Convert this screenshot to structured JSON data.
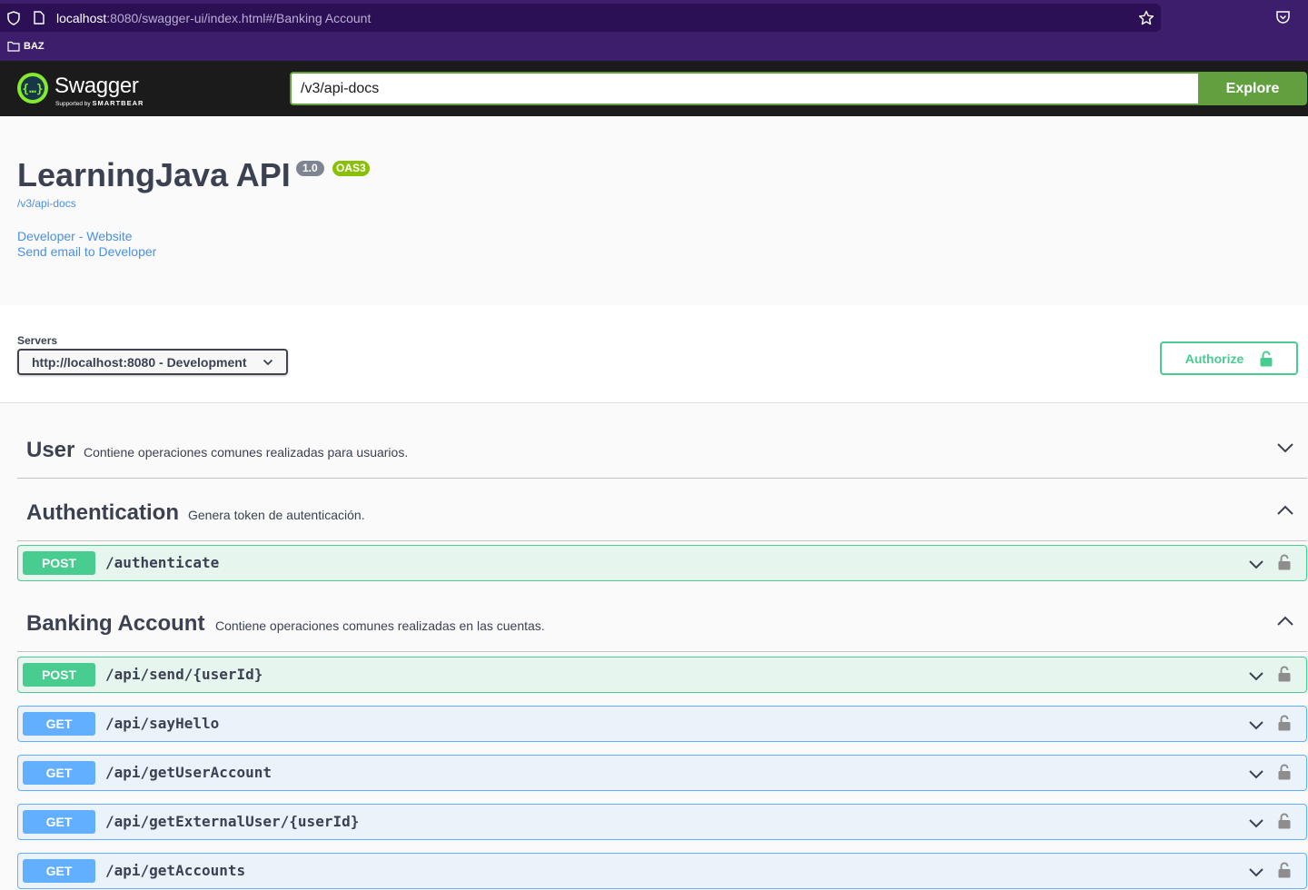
{
  "browser": {
    "url_host": "localhost",
    "url_rest": ":8080/swagger-ui/index.html#/Banking Account",
    "bookmark": "BAZ"
  },
  "topbar": {
    "brand": "Swagger",
    "supported_by": "Supported by",
    "smartbear": "SMARTBEAR",
    "spec_input_value": "/v3/api-docs",
    "explore_label": "Explore"
  },
  "info": {
    "title": "LearningJava API",
    "version": "1.0",
    "oas": "OAS3",
    "spec_url": "/v3/api-docs",
    "links": [
      "Developer - Website",
      "Send email to Developer"
    ]
  },
  "servers": {
    "label": "Servers",
    "selected": "http://localhost:8080 - Development",
    "authorize_label": "Authorize"
  },
  "tags": [
    {
      "name": "User",
      "description": "Contiene operaciones comunes realizadas para usuarios.",
      "expanded": false
    },
    {
      "name": "Authentication",
      "description": "Genera token de autenticación.",
      "expanded": true
    },
    {
      "name": "Banking Account",
      "description": "Contiene operaciones comunes realizadas en las cuentas.",
      "expanded": true
    }
  ],
  "operations": [
    {
      "method": "POST",
      "path": "/authenticate"
    },
    {
      "method": "POST",
      "path": "/api/send/{userId}"
    },
    {
      "method": "GET",
      "path": "/api/sayHello"
    },
    {
      "method": "GET",
      "path": "/api/getUserAccount"
    },
    {
      "method": "GET",
      "path": "/api/getExternalUser/{userId}"
    },
    {
      "method": "GET",
      "path": "/api/getAccounts"
    }
  ],
  "colors": {
    "post": "#49cc90",
    "get": "#61affe",
    "swagger_green": "#62a03f",
    "link": "#4990e2"
  }
}
